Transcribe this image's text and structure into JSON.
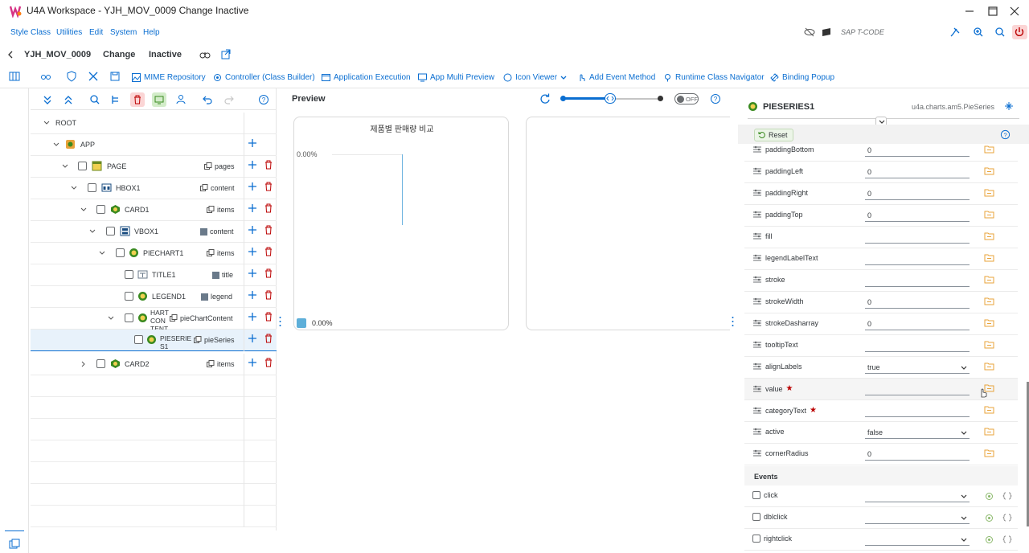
{
  "window": {
    "title": "U4A Workspace - YJH_MOV_0009 Change Inactive"
  },
  "menu": [
    "Style Class",
    "Utilities",
    "Edit",
    "System",
    "Help"
  ],
  "sap_tcode": "SAP T-CODE",
  "appbar": {
    "app_id": "YJH_MOV_0009",
    "mode": "Change",
    "status": "Inactive"
  },
  "toolbar": {
    "mime": "MIME Repository",
    "controller": "Controller (Class Builder)",
    "app_exec": "Application Execution",
    "multi_preview": "App Multi Preview",
    "icon_viewer": "Icon Viewer",
    "add_event": "Add Event Method",
    "runtime_nav": "Runtime Class Navigator",
    "binding_popup": "Binding Popup"
  },
  "tree": {
    "rows": [
      {
        "name": "ROOT",
        "agg": ""
      },
      {
        "name": "APP",
        "agg": ""
      },
      {
        "name": "PAGE",
        "agg": "pages"
      },
      {
        "name": "HBOX1",
        "agg": "content"
      },
      {
        "name": "CARD1",
        "agg": "items"
      },
      {
        "name": "VBOX1",
        "agg": "content"
      },
      {
        "name": "PIECHART1",
        "agg": "items"
      },
      {
        "name": "TITLE1",
        "agg": "title"
      },
      {
        "name": "LEGEND1",
        "agg": "legend"
      },
      {
        "name": "HART CON TENT",
        "agg": "pieChartContent"
      },
      {
        "name": "PIESERIE S1",
        "agg": "pieSeries"
      },
      {
        "name": "CARD2",
        "agg": "items"
      }
    ]
  },
  "preview": {
    "header": "Preview",
    "toggle": "OFF",
    "chart_title": "제품별 판매량 비교",
    "pct_label": "0.00%",
    "legend_label": "0.00%"
  },
  "props": {
    "title": "PIESERIES1",
    "class": "u4a.charts.am5.PieSeries",
    "reset": "Reset",
    "rows": [
      {
        "label": "paddingBottom",
        "value": "0"
      },
      {
        "label": "paddingLeft",
        "value": "0"
      },
      {
        "label": "paddingRight",
        "value": "0"
      },
      {
        "label": "paddingTop",
        "value": "0"
      },
      {
        "label": "fill",
        "value": ""
      },
      {
        "label": "legendLabelText",
        "value": ""
      },
      {
        "label": "stroke",
        "value": ""
      },
      {
        "label": "strokeWidth",
        "value": "0"
      },
      {
        "label": "strokeDasharray",
        "value": "0"
      },
      {
        "label": "tooltipText",
        "value": ""
      },
      {
        "label": "alignLabels",
        "value": "true"
      },
      {
        "label": "value",
        "value": ""
      },
      {
        "label": "categoryText",
        "value": ""
      },
      {
        "label": "active",
        "value": "false"
      },
      {
        "label": "cornerRadius",
        "value": "0"
      }
    ],
    "events_header": "Events",
    "events": [
      "click",
      "dblclick",
      "rightclick"
    ]
  },
  "colors": {
    "accent": "#0a6ed1",
    "delete": "#bb0000",
    "legend": "#5eafd9",
    "selected_row": "#e8f2fb"
  }
}
